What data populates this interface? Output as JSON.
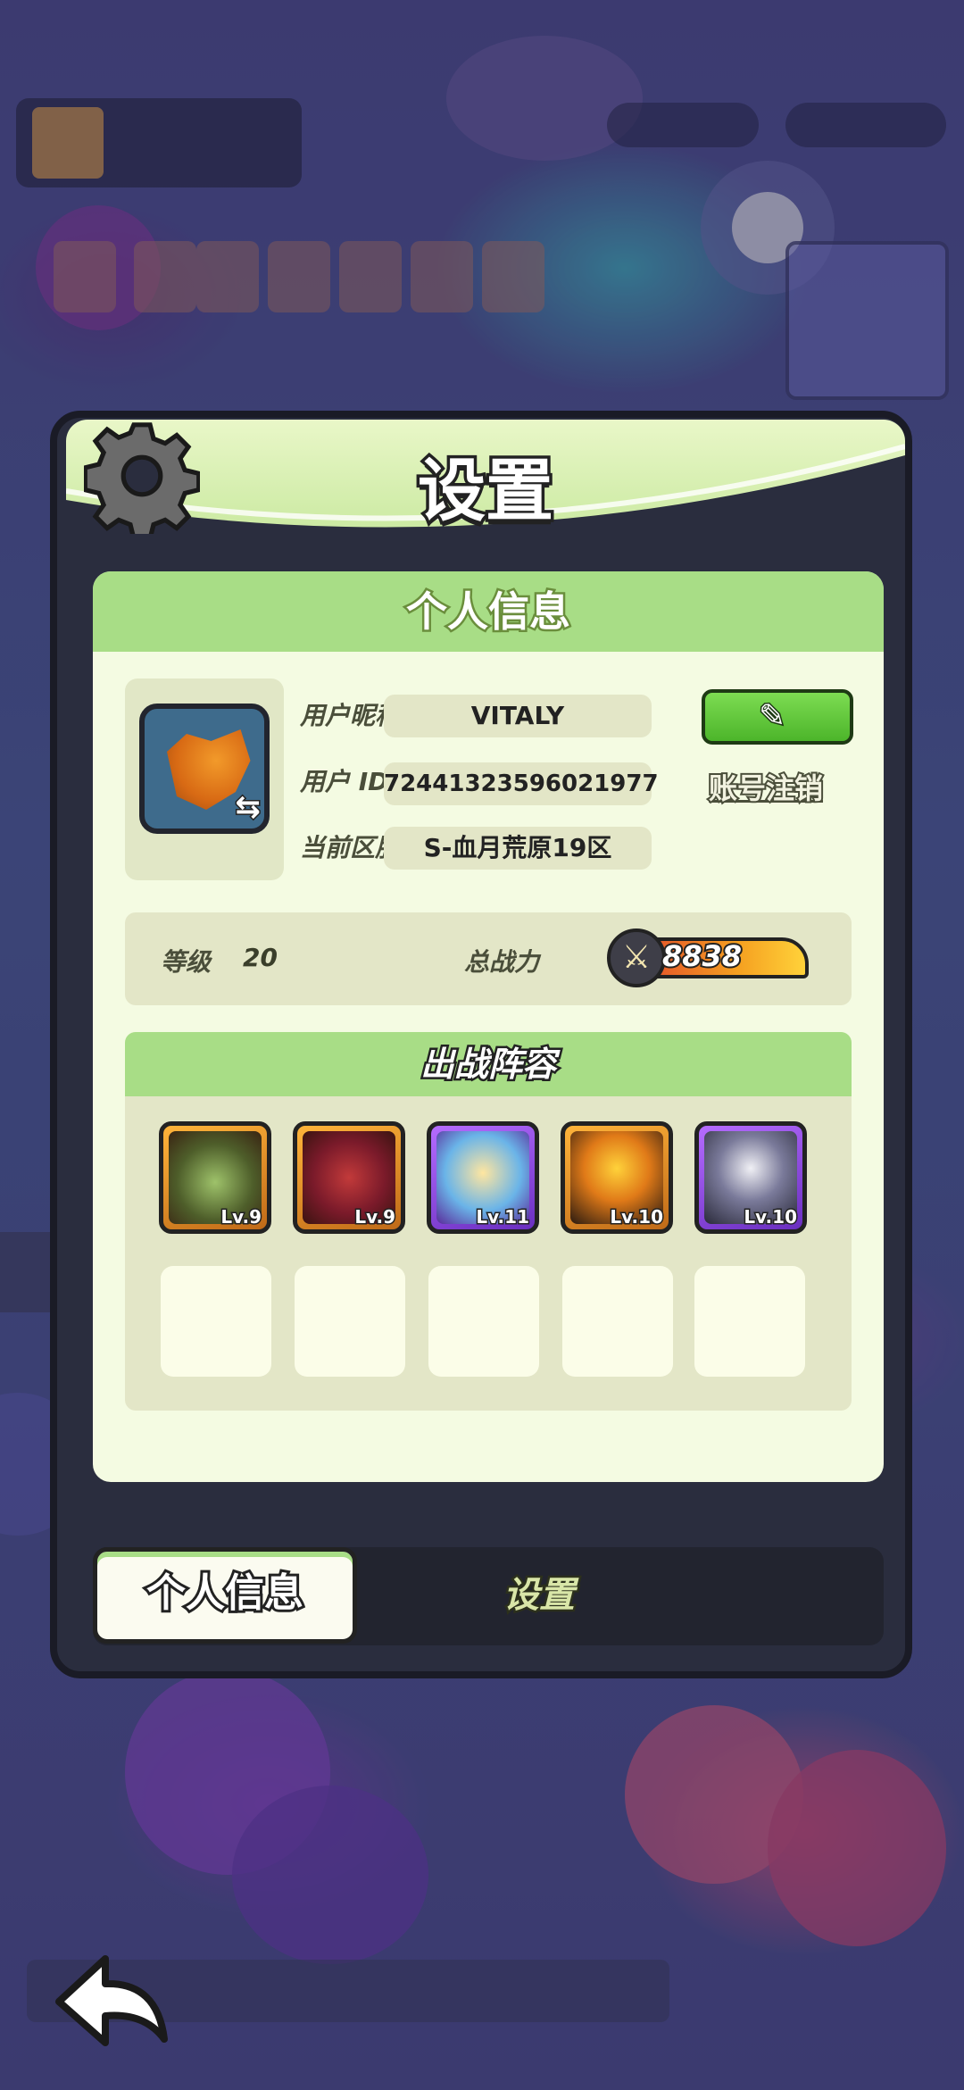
{
  "dialog": {
    "title": "设置",
    "section_title": "个人信息",
    "profile": {
      "nickname_label": "用户昵称",
      "nickname": "VITALY",
      "uid_label": "用户 ID",
      "uid": "72441323596021977",
      "server_label": "当前区服",
      "server": "S-血月荒原19区",
      "cancel_account": "账号注销"
    },
    "stats": {
      "level_label": "等级",
      "level": "20",
      "power_label": "总战力",
      "power": "8838"
    },
    "team": {
      "title": "出战阵容",
      "heroes": [
        {
          "level": "Lv.9",
          "rarity": "gold"
        },
        {
          "level": "Lv.9",
          "rarity": "gold"
        },
        {
          "level": "Lv.11",
          "rarity": "purple"
        },
        {
          "level": "Lv.10",
          "rarity": "gold"
        },
        {
          "level": "Lv.10",
          "rarity": "purple"
        }
      ],
      "empty_slots": 5
    },
    "tabs": {
      "active": "个人信息",
      "inactive": "设置"
    }
  },
  "colors": {
    "panel": "#f4fbe2",
    "header_green": "#a8dd86",
    "edit_button": "#4cb52a",
    "dialog_frame": "#2a2d3e"
  },
  "icons": [
    "gear-icon",
    "edit-pen-icon",
    "swap-icon",
    "crossed-swords-icon",
    "back-arrow-icon"
  ]
}
